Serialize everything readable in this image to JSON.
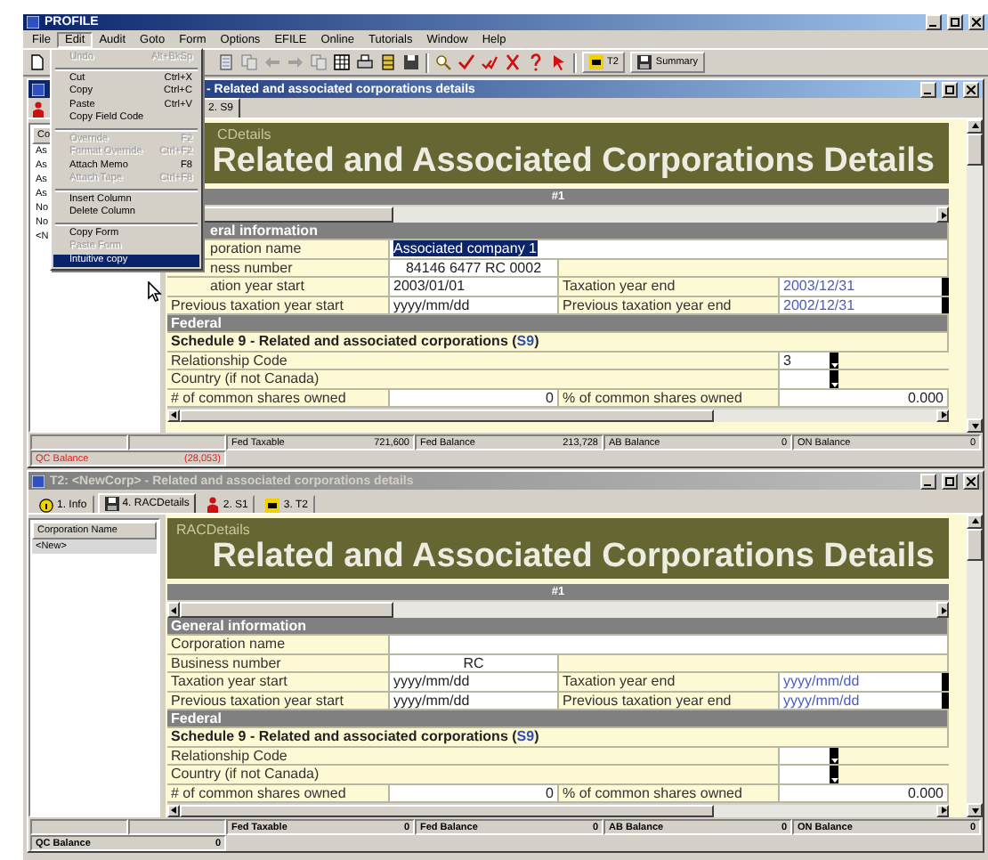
{
  "app": {
    "title": "PROFILE"
  },
  "menu": [
    {
      "label": "File",
      "open": false
    },
    {
      "label": "Edit",
      "open": true
    },
    {
      "label": "Audit",
      "open": false
    },
    {
      "label": "Goto",
      "open": false
    },
    {
      "label": "Form",
      "open": false
    },
    {
      "label": "Options",
      "open": false
    },
    {
      "label": "EFILE",
      "open": false
    },
    {
      "label": "Online",
      "open": false
    },
    {
      "label": "Tutorials",
      "open": false
    },
    {
      "label": "Window",
      "open": false
    },
    {
      "label": "Help",
      "open": false
    }
  ],
  "toolbar": {
    "buttons": [
      "T2",
      "Summary"
    ]
  },
  "edit_menu": [
    {
      "kind": "item",
      "label": "Undo",
      "shortcut": "Alt+BkSp",
      "disabled": true,
      "selected": false
    },
    {
      "kind": "separator"
    },
    {
      "kind": "item",
      "label": "Cut",
      "shortcut": "Ctrl+X",
      "disabled": false,
      "selected": false
    },
    {
      "kind": "item",
      "label": "Copy",
      "shortcut": "Ctrl+C",
      "disabled": false,
      "selected": false
    },
    {
      "kind": "item",
      "label": "Paste",
      "shortcut": "Ctrl+V",
      "disabled": false,
      "selected": false
    },
    {
      "kind": "item",
      "label": "Copy Field Code",
      "disabled": false,
      "selected": false
    },
    {
      "kind": "separator"
    },
    {
      "kind": "item",
      "label": "Override",
      "shortcut": "F2",
      "disabled": true,
      "selected": false
    },
    {
      "kind": "item",
      "label": "Format Override",
      "shortcut": "Ctrl+F2",
      "disabled": true,
      "selected": false
    },
    {
      "kind": "item",
      "label": "Attach Memo",
      "shortcut": "F8",
      "disabled": false,
      "selected": false
    },
    {
      "kind": "item",
      "label": "Attach Tape",
      "shortcut": "Ctrl+F8",
      "disabled": true,
      "selected": false
    },
    {
      "kind": "separator"
    },
    {
      "kind": "item",
      "label": "Insert Column",
      "disabled": false,
      "selected": false
    },
    {
      "kind": "item",
      "label": "Delete Column",
      "disabled": false,
      "selected": false
    },
    {
      "kind": "separator"
    },
    {
      "kind": "item",
      "label": "Copy Form",
      "disabled": false,
      "selected": false
    },
    {
      "kind": "item",
      "label": "Paste Form",
      "disabled": true,
      "selected": false
    },
    {
      "kind": "item",
      "label": "Intuitive copy",
      "disabled": false,
      "selected": true
    }
  ],
  "windows": [
    {
      "title": "- Related and associated corporations details",
      "active": true,
      "tabs": [
        {
          "label": "2. S9",
          "selected": true
        }
      ],
      "list": {
        "header": "Co",
        "items": [
          {
            "label": "As",
            "selected": false
          },
          {
            "label": "As",
            "selected": false
          },
          {
            "label": "As",
            "selected": false
          },
          {
            "label": "As",
            "selected": false
          },
          {
            "label": "No",
            "selected": false
          },
          {
            "label": "No",
            "selected": false
          },
          {
            "label": "<N",
            "selected": false
          }
        ]
      },
      "form": {
        "tag": "CDetails",
        "title": "Related and Associated Corporations Details",
        "column": "#1",
        "rows": [
          {
            "kind": "section",
            "label": "eral information"
          },
          {
            "kind": "wide",
            "label": "poration name",
            "value": "Associated company 1",
            "highlighted": true
          },
          {
            "kind": "single",
            "label": "ness number",
            "value": "84146 6477 RC 0002"
          },
          {
            "kind": "pair",
            "label": "ation year start",
            "value": "2003/01/01",
            "label2": "Taxation year end",
            "value2": "2003/12/31"
          },
          {
            "kind": "pair",
            "label": "Previous taxation year start",
            "value": "yyyy/mm/dd",
            "label2": "Previous taxation year end",
            "value2": "2002/12/31"
          },
          {
            "kind": "section",
            "label": "Federal"
          },
          {
            "kind": "schedule",
            "prefix": "Schedule 9 - Related and associated corporations (",
            "link": "S9",
            "suffix": ")"
          },
          {
            "kind": "dropdown",
            "label": "Relationship Code",
            "value": "3"
          },
          {
            "kind": "dropdown",
            "label": "Country (if not Canada)"
          },
          {
            "kind": "numeric",
            "label": "# of common shares owned",
            "value": "0",
            "label2": "% of common shares owned",
            "value2": "0.000"
          }
        ]
      },
      "status": {
        "cells": [
          {
            "label": "Fed Taxable",
            "value": "721,600"
          },
          {
            "label": "Fed Balance",
            "value": "213,728"
          },
          {
            "label": "AB Balance",
            "value": "0"
          },
          {
            "label": "ON Balance",
            "value": "0"
          }
        ],
        "qc": {
          "label": "QC Balance",
          "value": "(28,053)",
          "alert": true
        }
      }
    },
    {
      "title": "T2: <NewCorp> - Related and associated corporations details",
      "active": false,
      "tabs": [
        {
          "label": "1. Info",
          "selected": false
        },
        {
          "label": "4. RACDetails",
          "selected": true
        },
        {
          "label": "2. S1",
          "selected": false
        },
        {
          "label": "3. T2",
          "selected": false
        }
      ],
      "list": {
        "header": "Corporation Name",
        "items": [
          {
            "label": "<New>",
            "selected": true
          }
        ]
      },
      "form": {
        "tag": "RACDetails",
        "title": "Related and Associated Corporations Details",
        "column": "#1",
        "rows": [
          {
            "kind": "section",
            "label": "General information"
          },
          {
            "kind": "wide",
            "label": "Corporation name"
          },
          {
            "kind": "single",
            "label": "Business number",
            "value": "RC"
          },
          {
            "kind": "pair",
            "label": "Taxation year start",
            "value": "yyyy/mm/dd",
            "label2": "Taxation year end",
            "value2": "yyyy/mm/dd"
          },
          {
            "kind": "pair",
            "label": "Previous taxation year start",
            "value": "yyyy/mm/dd",
            "label2": "Previous taxation year end",
            "value2": "yyyy/mm/dd"
          },
          {
            "kind": "section",
            "label": "Federal"
          },
          {
            "kind": "schedule",
            "prefix": "Schedule 9 - Related and associated corporations (",
            "link": "S9",
            "suffix": ")"
          },
          {
            "kind": "dropdown",
            "label": "Relationship Code"
          },
          {
            "kind": "dropdown",
            "label": "Country (if not Canada)"
          },
          {
            "kind": "numeric",
            "label": "# of common shares owned",
            "value": "0",
            "label2": "% of common shares owned",
            "value2": "0.000"
          }
        ]
      },
      "status": {
        "cells": [
          {
            "label": "Fed Taxable",
            "value": "0"
          },
          {
            "label": "Fed Balance",
            "value": "0"
          },
          {
            "label": "AB Balance",
            "value": "0"
          },
          {
            "label": "ON Balance",
            "value": "0"
          }
        ],
        "qc": {
          "label": "QC Balance",
          "value": "0",
          "alert": false
        }
      }
    }
  ]
}
